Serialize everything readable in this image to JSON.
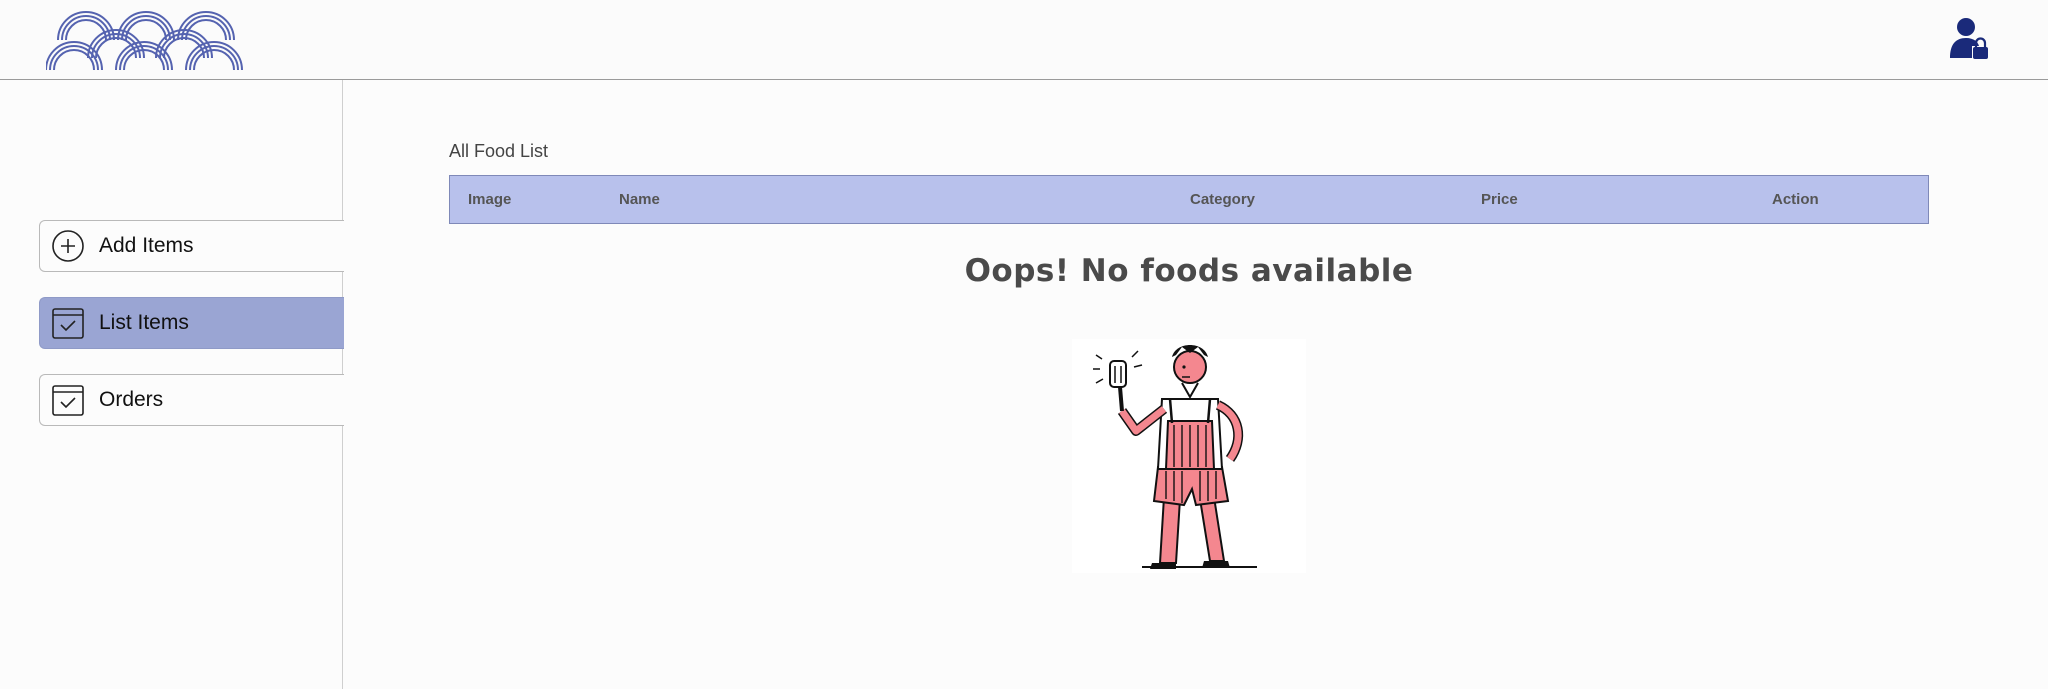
{
  "header": {
    "logo_icon": "wave-arcs-logo",
    "admin_icon": "user-lock-icon",
    "accent_color": "#1a2a7a"
  },
  "sidebar": {
    "items": [
      {
        "label": "Add Items",
        "icon": "plus-circle-icon",
        "active": false
      },
      {
        "label": "List Items",
        "icon": "checkbox-icon",
        "active": true
      },
      {
        "label": "Orders",
        "icon": "checkbox-icon",
        "active": false
      }
    ],
    "active_color": "#9aa5d3"
  },
  "main": {
    "section_title": "All Food List",
    "table": {
      "columns": [
        "Image",
        "Name",
        "Category",
        "Price",
        "Action"
      ],
      "rows": []
    },
    "empty_message": "Oops! No foods available",
    "illustration_icon": "chef-with-spatula-illustration"
  }
}
